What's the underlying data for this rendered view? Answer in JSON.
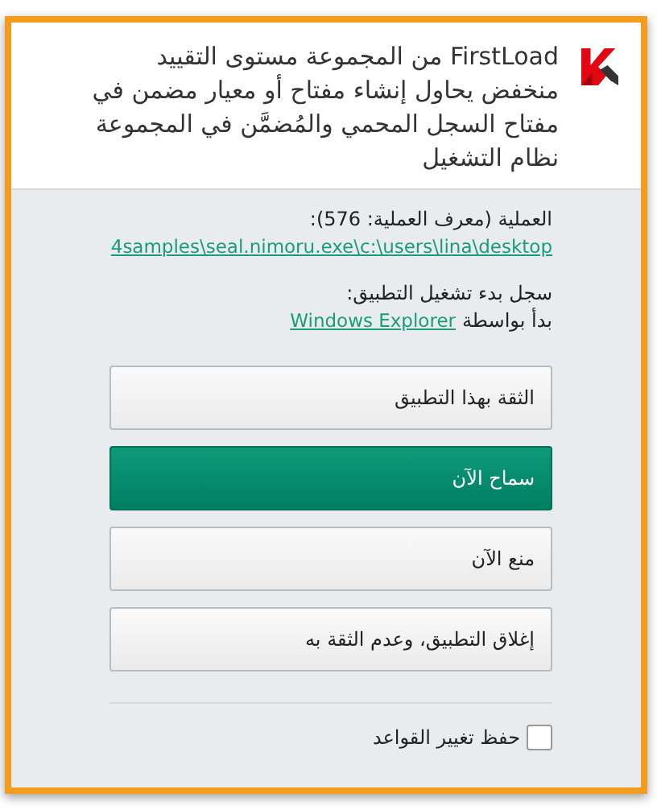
{
  "header": {
    "message": "FirstLoad من المجموعة مستوى التقييد منخفض يحاول إنشاء مفتاح أو معيار مضمن في مفتاح السجل المحمي والمُضمَّن في المجموعة نظام التشغيل"
  },
  "process": {
    "label": "العملية (معرف العملية: 576):",
    "path": "4samples\\seal.nimoru.exe\\c:\\users\\lina\\desktop"
  },
  "launch": {
    "label": "سجل بدء تشغيل التطبيق:",
    "prefix": "بدأ بواسطة",
    "link": "Windows Explorer"
  },
  "buttons": [
    {
      "label": "الثقة بهذا التطبيق",
      "kind": "normal"
    },
    {
      "label": "سماح الآن",
      "kind": "primary"
    },
    {
      "label": "منع الآن",
      "kind": "normal"
    },
    {
      "label": "إغلاق التطبيق، وعدم الثقة به",
      "kind": "normal"
    }
  ],
  "save_rules": {
    "label": "حفظ تغيير القواعد",
    "checked": false
  }
}
